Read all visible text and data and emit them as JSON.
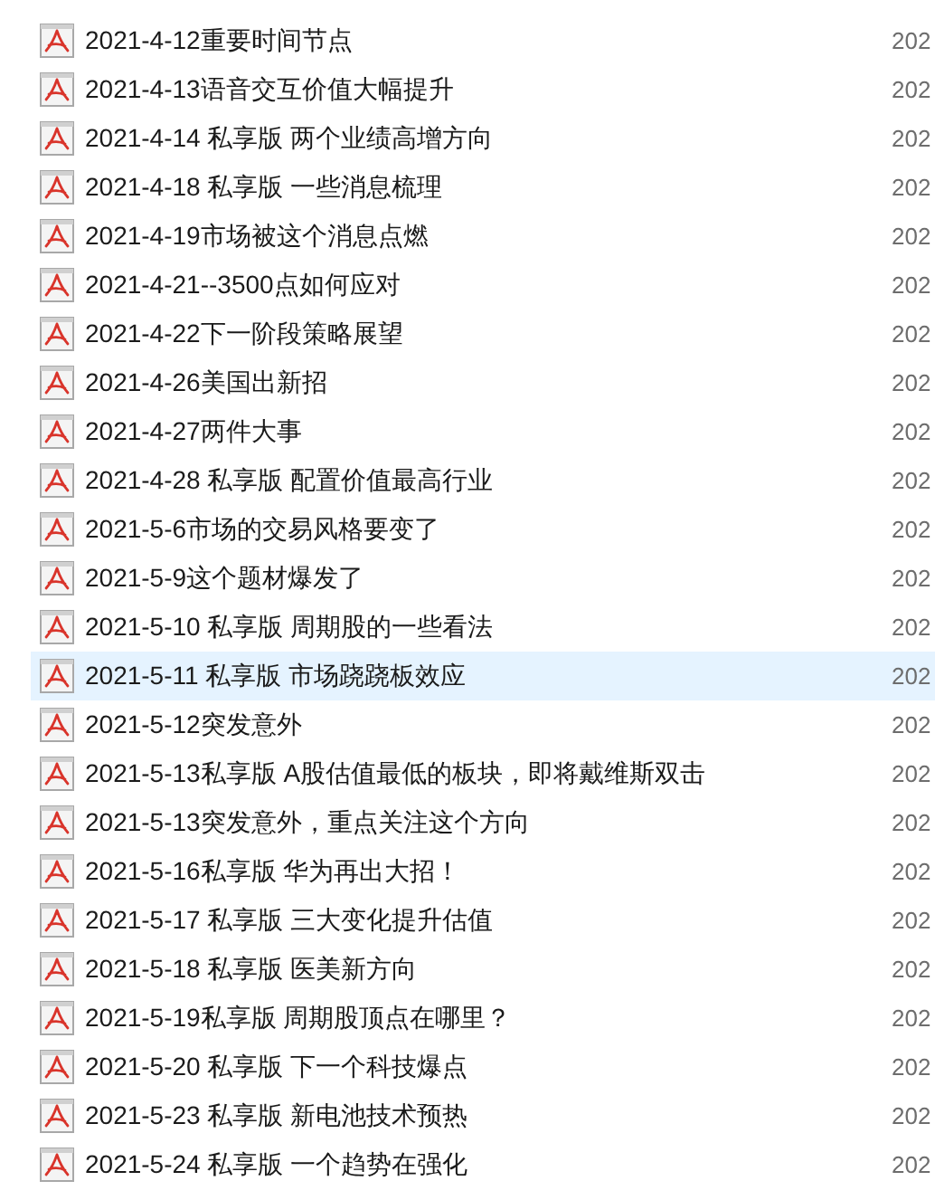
{
  "files": [
    {
      "name": "2021-4-12重要时间节点",
      "date": "202",
      "selected": false
    },
    {
      "name": "2021-4-13语音交互价值大幅提升",
      "date": "202",
      "selected": false
    },
    {
      "name": "2021-4-14 私享版 两个业绩高增方向",
      "date": "202",
      "selected": false
    },
    {
      "name": "2021-4-18 私享版 一些消息梳理",
      "date": "202",
      "selected": false
    },
    {
      "name": "2021-4-19市场被这个消息点燃",
      "date": "202",
      "selected": false
    },
    {
      "name": "2021-4-21--3500点如何应对",
      "date": "202",
      "selected": false
    },
    {
      "name": "2021-4-22下一阶段策略展望",
      "date": "202",
      "selected": false
    },
    {
      "name": "2021-4-26美国出新招",
      "date": "202",
      "selected": false
    },
    {
      "name": "2021-4-27两件大事",
      "date": "202",
      "selected": false
    },
    {
      "name": "2021-4-28 私享版 配置价值最高行业",
      "date": "202",
      "selected": false
    },
    {
      "name": "2021-5-6市场的交易风格要变了",
      "date": "202",
      "selected": false
    },
    {
      "name": "2021-5-9这个题材爆发了",
      "date": "202",
      "selected": false
    },
    {
      "name": "2021-5-10 私享版 周期股的一些看法",
      "date": "202",
      "selected": false
    },
    {
      "name": "2021-5-11 私享版 市场跷跷板效应",
      "date": "202",
      "selected": true
    },
    {
      "name": "2021-5-12突发意外",
      "date": "202",
      "selected": false
    },
    {
      "name": "2021-5-13私享版 A股估值最低的板块，即将戴维斯双击",
      "date": "202",
      "selected": false
    },
    {
      "name": "2021-5-13突发意外，重点关注这个方向",
      "date": "202",
      "selected": false
    },
    {
      "name": "2021-5-16私享版 华为再出大招！",
      "date": "202",
      "selected": false
    },
    {
      "name": "2021-5-17 私享版 三大变化提升估值",
      "date": "202",
      "selected": false
    },
    {
      "name": "2021-5-18 私享版 医美新方向",
      "date": "202",
      "selected": false
    },
    {
      "name": "2021-5-19私享版 周期股顶点在哪里？",
      "date": "202",
      "selected": false
    },
    {
      "name": "2021-5-20 私享版 下一个科技爆点",
      "date": "202",
      "selected": false
    },
    {
      "name": "2021-5-23 私享版 新电池技术预热",
      "date": "202",
      "selected": false
    },
    {
      "name": "2021-5-24 私享版 一个趋势在强化",
      "date": "202",
      "selected": false
    }
  ]
}
